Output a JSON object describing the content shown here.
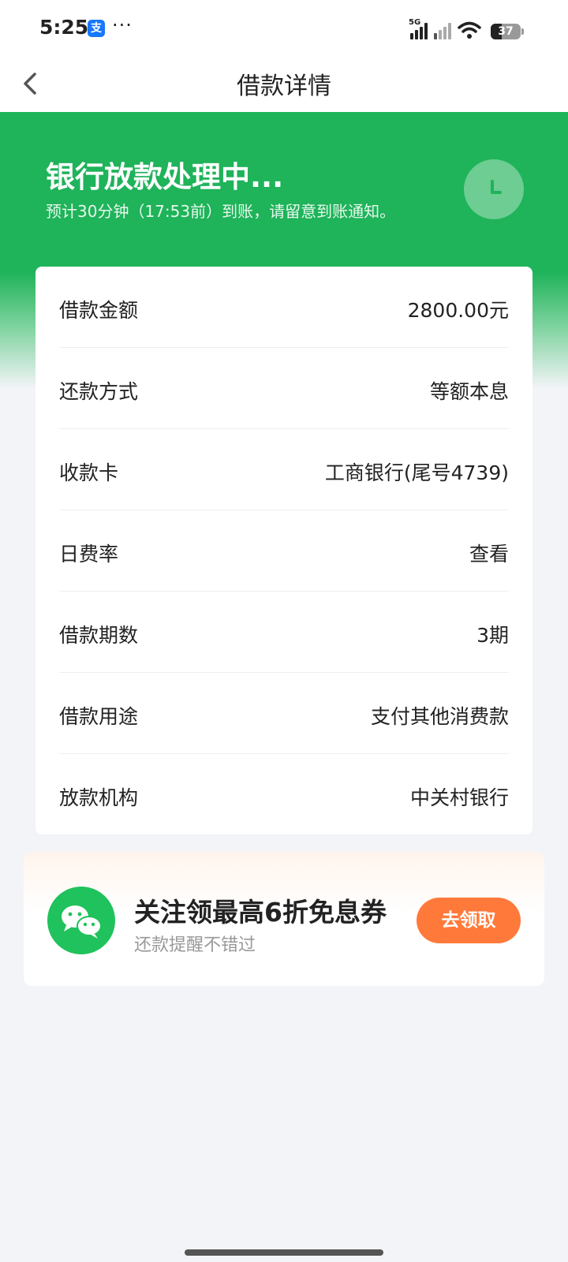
{
  "status_bar": {
    "time": "5:25",
    "notification_app": "支",
    "more": "···",
    "network_tag": "5G",
    "battery": "37"
  },
  "nav": {
    "title": "借款详情"
  },
  "status": {
    "title": "银行放款处理中...",
    "subtitle": "预计30分钟（17:53前）到账，请留意到账通知。"
  },
  "details": {
    "rows": [
      {
        "label": "借款金额",
        "value": "2800.00元"
      },
      {
        "label": "还款方式",
        "value": "等额本息"
      },
      {
        "label": "收款卡",
        "value": "工商银行(尾号4739)"
      },
      {
        "label": "日费率",
        "value": "查看"
      },
      {
        "label": "借款期数",
        "value": "3期"
      },
      {
        "label": "借款用途",
        "value": "支付其他消费款"
      },
      {
        "label": "放款机构",
        "value": "中关村银行"
      }
    ]
  },
  "promo": {
    "title": "关注领最高6折免息券",
    "subtitle": "还款提醒不错过",
    "button": "去领取"
  },
  "colors": {
    "brand_green": "#1fb35a",
    "accent_orange": "#ff7a3a",
    "wechat_green": "#1fc25c"
  }
}
